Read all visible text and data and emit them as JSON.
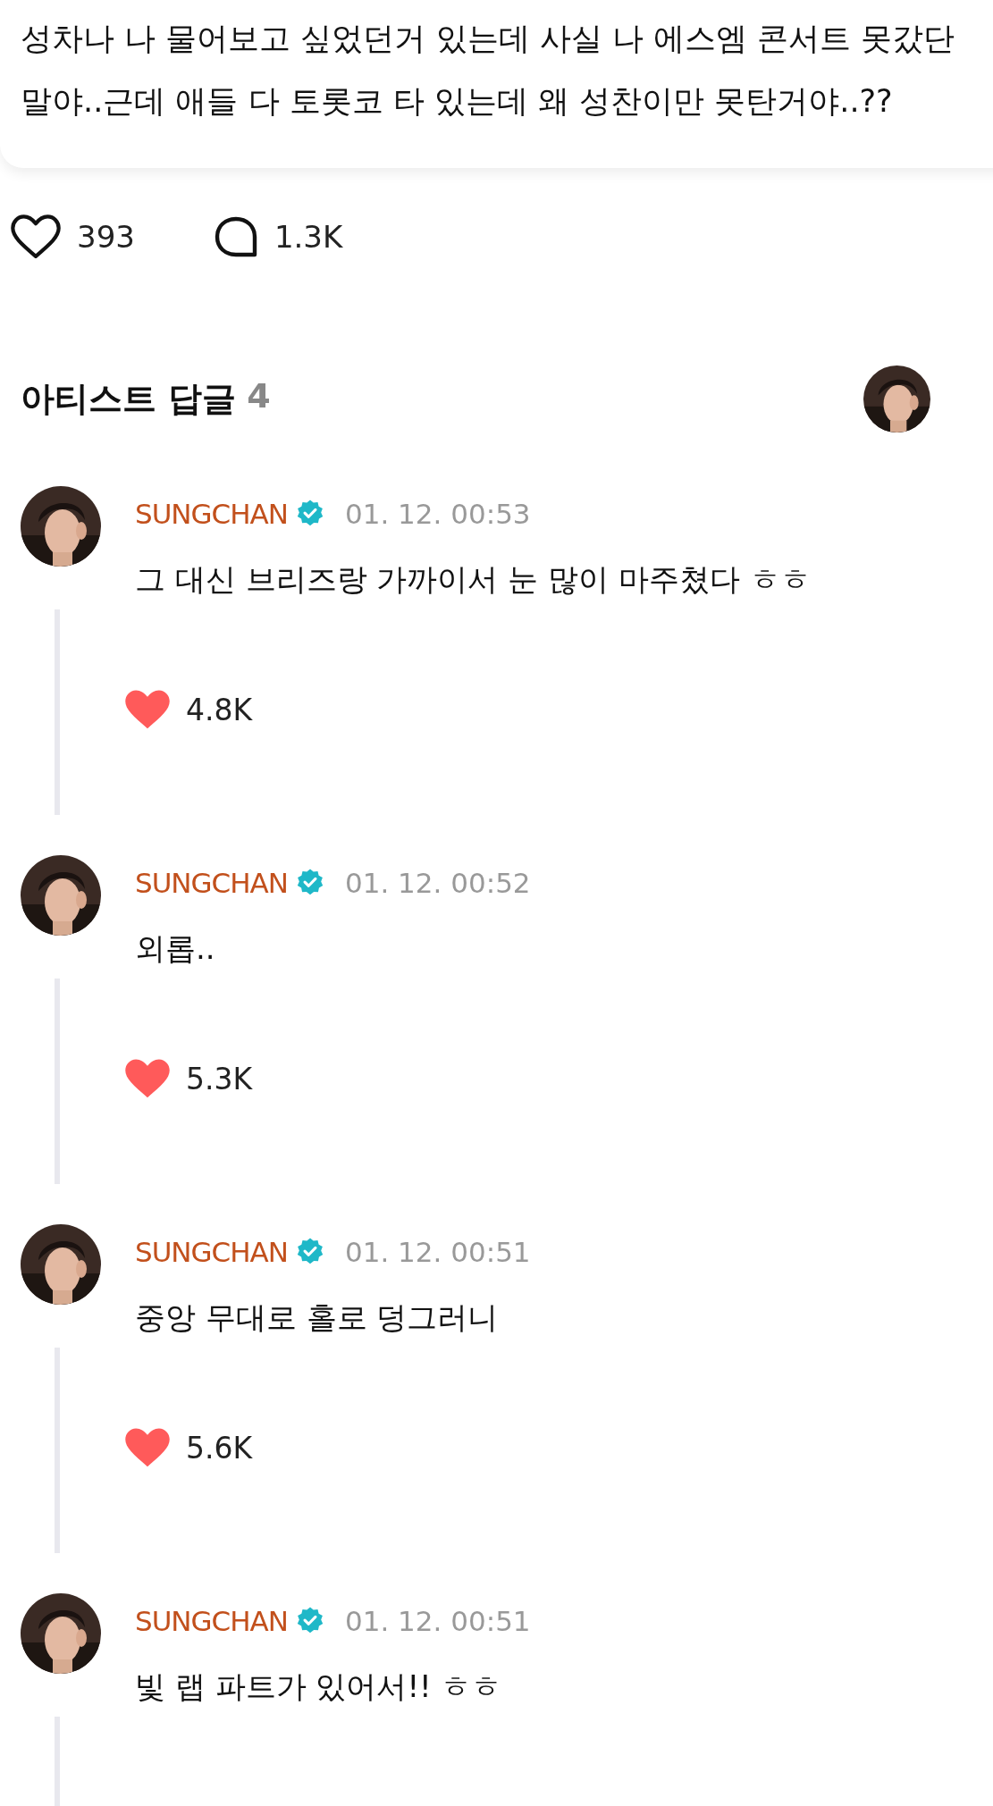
{
  "post": {
    "text": "성차나 나 물어보고 싶었던거 있는데 사실 나 에스엠 콘서트 못갔단 말야..근데 애들 다 토롯코 타 있는데 왜 성찬이만 못탄거야..??",
    "liked": false,
    "likes": "393",
    "comments": "1.3K"
  },
  "artist_replies": {
    "title": "아티스트 답글",
    "count": "4",
    "replies": [
      {
        "author": "SUNGCHAN",
        "verified": true,
        "time": "01. 12. 00:53",
        "text": "그 대신 브리즈랑 가까이서 눈 많이 마주쳤다 ㅎㅎ",
        "liked": true,
        "likes": "4.8K"
      },
      {
        "author": "SUNGCHAN",
        "verified": true,
        "time": "01. 12. 00:52",
        "text": "외롭..",
        "liked": true,
        "likes": "5.3K"
      },
      {
        "author": "SUNGCHAN",
        "verified": true,
        "time": "01. 12. 00:51",
        "text": "중앙 무대로 홀로 덩그러니",
        "liked": true,
        "likes": "5.6K"
      },
      {
        "author": "SUNGCHAN",
        "verified": true,
        "time": "01. 12. 00:51",
        "text": "빛 랩 파트가 있어서!! ㅎㅎ"
      }
    ]
  }
}
